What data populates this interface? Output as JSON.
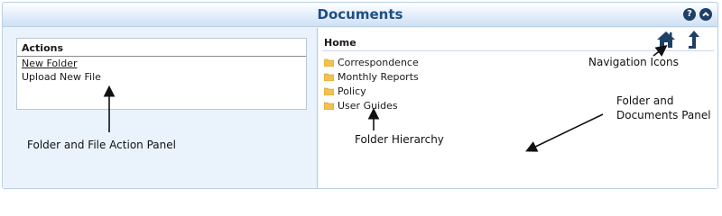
{
  "window": {
    "title": "Documents"
  },
  "title_icons": [
    {
      "name": "help-icon",
      "glyph": "?"
    },
    {
      "name": "collapse-icon",
      "glyph": "^"
    }
  ],
  "actions": {
    "title": "Actions",
    "items": [
      "New Folder",
      "Upload New File"
    ]
  },
  "breadcrumb": {
    "home": "Home"
  },
  "nav_icons": [
    "home-icon",
    "up-arrow-icon"
  ],
  "folders": [
    "Correspondence",
    "Monthly Reports",
    "Policy",
    "User Guides"
  ],
  "annotations": {
    "action_panel": "Folder and File Action Panel",
    "hierarchy": "Folder Hierarchy",
    "nav": "Navigation Icons",
    "docs_panel_line1": "Folder and",
    "docs_panel_line2": "Documents Panel"
  },
  "colors": {
    "title_text": "#1f4f83",
    "panel_bg": "#eaf3fc",
    "icon_dark": "#1e3f66",
    "folder_yellow": "#f2c14e"
  }
}
